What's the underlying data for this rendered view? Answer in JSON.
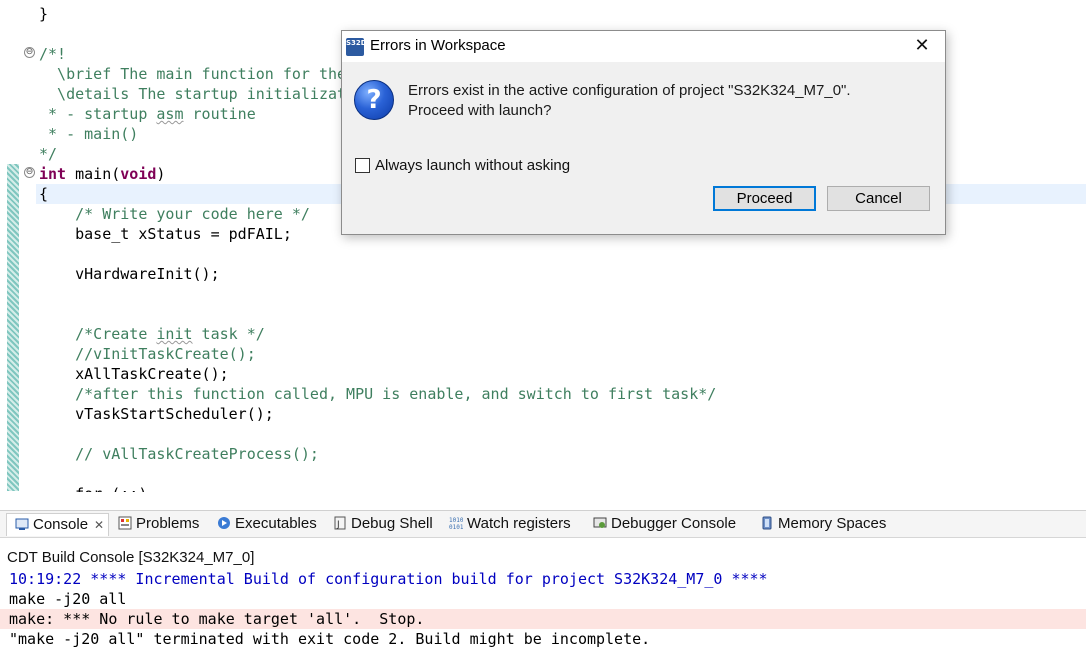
{
  "editor": {
    "lines": [
      {
        "segments": [
          {
            "t": "}",
            "c": ""
          }
        ]
      },
      {
        "segments": [
          {
            "t": "",
            "c": ""
          }
        ]
      },
      {
        "segments": [
          {
            "t": "/*!",
            "c": "cm"
          }
        ]
      },
      {
        "segments": [
          {
            "t": "  \\brief The main function for the",
            "c": "cm"
          }
        ]
      },
      {
        "segments": [
          {
            "t": "  \\details The startup initializat",
            "c": "cm"
          }
        ]
      },
      {
        "segments": [
          {
            "t": " * - startup ",
            "c": "cm"
          },
          {
            "t": "asm",
            "c": "cm sq"
          },
          {
            "t": " routine",
            "c": "cm"
          }
        ]
      },
      {
        "segments": [
          {
            "t": " * - main()",
            "c": "cm"
          }
        ]
      },
      {
        "segments": [
          {
            "t": "*/",
            "c": "cm"
          }
        ]
      },
      {
        "segments": [
          {
            "t": "int",
            "c": "kw"
          },
          {
            "t": " main(",
            "c": ""
          },
          {
            "t": "void",
            "c": "kw"
          },
          {
            "t": ")",
            "c": ""
          }
        ]
      },
      {
        "segments": [
          {
            "t": "{",
            "c": ""
          }
        ]
      },
      {
        "segments": [
          {
            "t": "    /* Write your code here */",
            "c": "cm"
          }
        ]
      },
      {
        "segments": [
          {
            "t": "    base_t xStatus = pdFAIL;",
            "c": ""
          }
        ]
      },
      {
        "segments": [
          {
            "t": "",
            "c": ""
          }
        ]
      },
      {
        "segments": [
          {
            "t": "    vHardwareInit();",
            "c": ""
          }
        ]
      },
      {
        "segments": [
          {
            "t": "",
            "c": ""
          }
        ]
      },
      {
        "segments": [
          {
            "t": "",
            "c": ""
          }
        ]
      },
      {
        "segments": [
          {
            "t": "    /*Create ",
            "c": "cm"
          },
          {
            "t": "init",
            "c": "cm sq"
          },
          {
            "t": " task */",
            "c": "cm"
          }
        ]
      },
      {
        "segments": [
          {
            "t": "    //vInitTaskCreate();",
            "c": "cm"
          }
        ]
      },
      {
        "segments": [
          {
            "t": "    xAllTaskCreate();",
            "c": ""
          }
        ]
      },
      {
        "segments": [
          {
            "t": "    /*after this function called, MPU is enable, and switch to first task*/",
            "c": "cm"
          }
        ]
      },
      {
        "segments": [
          {
            "t": "    vTaskStartScheduler();",
            "c": ""
          }
        ]
      },
      {
        "segments": [
          {
            "t": "",
            "c": ""
          }
        ]
      },
      {
        "segments": [
          {
            "t": "    // vAllTaskCreateProcess();",
            "c": "cm"
          }
        ]
      },
      {
        "segments": [
          {
            "t": "",
            "c": ""
          }
        ]
      },
      {
        "segments": [
          {
            "t": "    for (;;)",
            "c": ""
          }
        ]
      }
    ],
    "fold_glyph": "⊖",
    "scroll_left": "<"
  },
  "console": {
    "tabs": [
      {
        "label": "Console",
        "icon": "console-icon",
        "close": "✕"
      },
      {
        "label": "Problems",
        "icon": "problems-icon"
      },
      {
        "label": "Executables",
        "icon": "executables-icon"
      },
      {
        "label": "Debug Shell",
        "icon": "debug-shell-icon"
      },
      {
        "label": "Watch registers",
        "icon": "watch-registers-icon"
      },
      {
        "label": "Debugger Console",
        "icon": "debugger-console-icon"
      },
      {
        "label": "Memory Spaces",
        "icon": "memory-spaces-icon"
      }
    ],
    "title": "CDT Build Console [S32K324_M7_0]",
    "output": [
      {
        "text": "10:19:22 **** Incremental Build of configuration build for project S32K324_M7_0 ****",
        "kind": "info"
      },
      {
        "text": "make -j20 all",
        "kind": "normal"
      },
      {
        "text": "make: *** No rule to make target 'all'.  Stop.",
        "kind": "error"
      },
      {
        "text": "\"make -j20 all\" terminated with exit code 2. Build might be incomplete.",
        "kind": "normal"
      }
    ]
  },
  "dialog": {
    "title": "Errors in Workspace",
    "app_icon_text": "S32DS",
    "close_glyph": "✕",
    "question_glyph": "?",
    "message_line1": "Errors exist in the active configuration of project \"S32K324_M7_0\".",
    "message_line2": "Proceed with launch?",
    "checkbox_label": "Always launch without asking",
    "checkbox_checked": false,
    "proceed_label": "Proceed",
    "cancel_label": "Cancel",
    "accent_color": "#0078d7"
  }
}
